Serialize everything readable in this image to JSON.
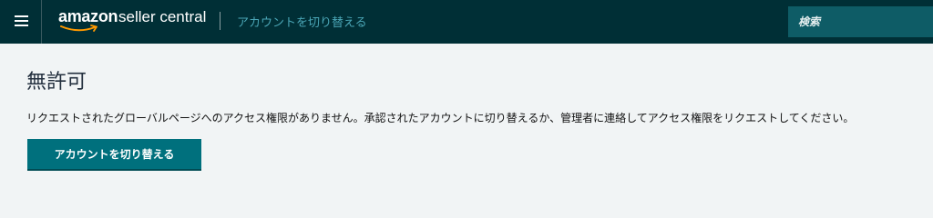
{
  "header": {
    "menu_icon": "hamburger-menu-icon",
    "logo": {
      "brand": "amazon",
      "suffix": "seller central"
    },
    "switch_account_link": "アカウントを切り替える",
    "search": {
      "placeholder": "検索"
    }
  },
  "main": {
    "title": "無許可",
    "message": "リクエストされたグローバルページへのアクセス権限がありません。承認されたアカウントに切り替えるか、管理者に連絡してアクセス権限をリクエストしてください。",
    "button_label": "アカウントを切り替える"
  },
  "colors": {
    "header_bg": "#002f36",
    "page_bg": "#f1f4f5",
    "link": "#4aa6b6",
    "button_bg": "#00707d",
    "search_bg": "#0e5c66"
  }
}
